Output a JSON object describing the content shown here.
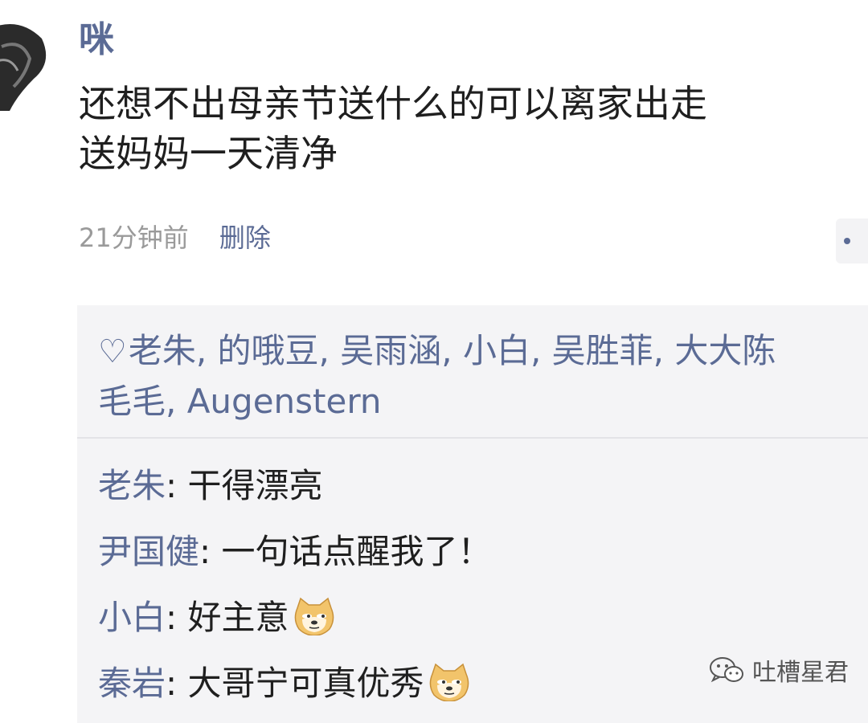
{
  "post": {
    "username": "咪",
    "text_line1": "还想不出母亲节送什么的可以离家出走",
    "text_line2": "送妈妈一天清净",
    "time": "21分钟前",
    "delete_label": "删除"
  },
  "likes": {
    "line1": "老朱, 的哦豆, 吴雨涵, 小白, 吴胜菲, 大大陈",
    "line2": "毛毛, Augenstern"
  },
  "comments": [
    {
      "author": "老朱",
      "text": ": 干得漂亮",
      "emoji": ""
    },
    {
      "author": "尹国健",
      "text": ": 一句话点醒我了！",
      "emoji": ""
    },
    {
      "author": "小白",
      "text": ": 好主意",
      "emoji": "doge-icon"
    },
    {
      "author": "秦岩",
      "text": ": 大哥宁可真优秀",
      "emoji": "doge-icon"
    }
  ],
  "watermark": {
    "text": "吐槽星君"
  },
  "colors": {
    "link": "#5b6b95",
    "text": "#1f1f1f",
    "muted": "#9a9a9a",
    "panel": "#f4f4f6"
  }
}
